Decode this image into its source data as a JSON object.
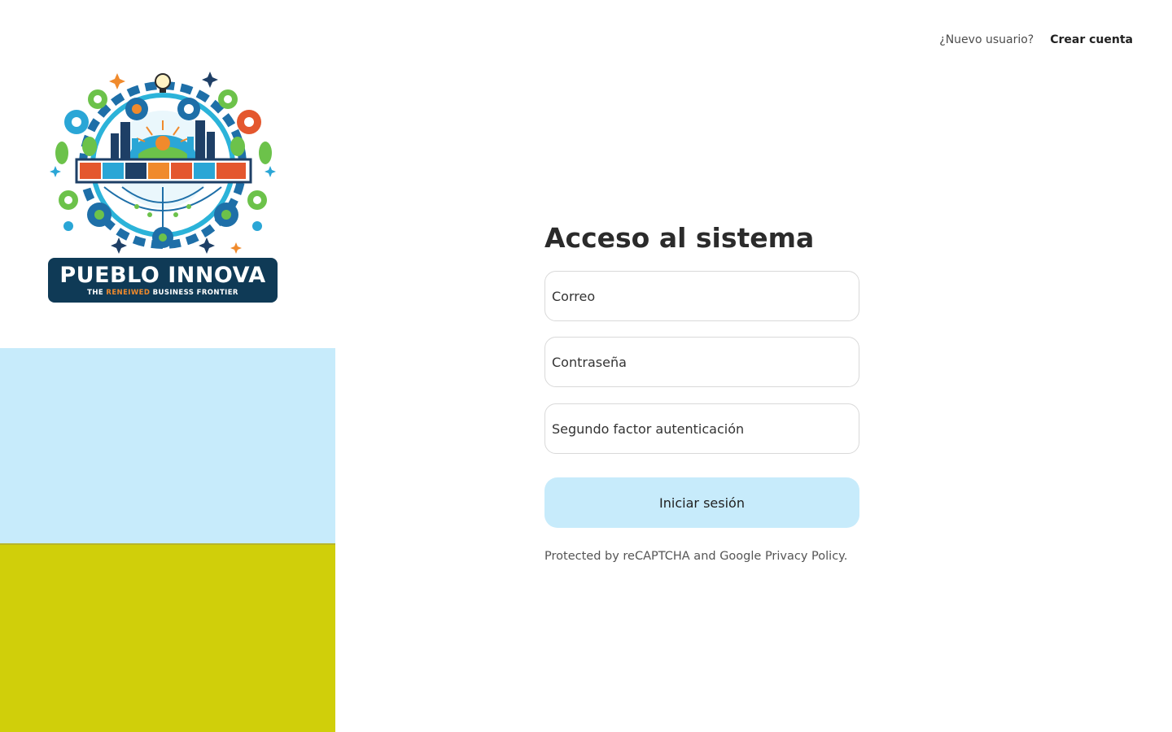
{
  "colors": {
    "accent_light_blue": "#c7ebfb",
    "accent_lime": "#d0cf0a"
  },
  "brand": {
    "name": "PUEBLO INNOVA",
    "tagline_start": "THE ",
    "tagline_highlight": "RENEIWED",
    "tagline_end": " BUSINESS FRONTIER"
  },
  "header": {
    "new_user_question": "¿Nuevo usuario?",
    "create_account_link": "Crear cuenta"
  },
  "login": {
    "title": "Acceso al sistema",
    "email_placeholder": "Correo",
    "password_placeholder": "Contraseña",
    "second_factor_placeholder": "Segundo factor autenticación",
    "submit_label": "Iniciar sesión",
    "legal_text": "Protected by reCAPTCHA and Google Privacy Policy."
  }
}
